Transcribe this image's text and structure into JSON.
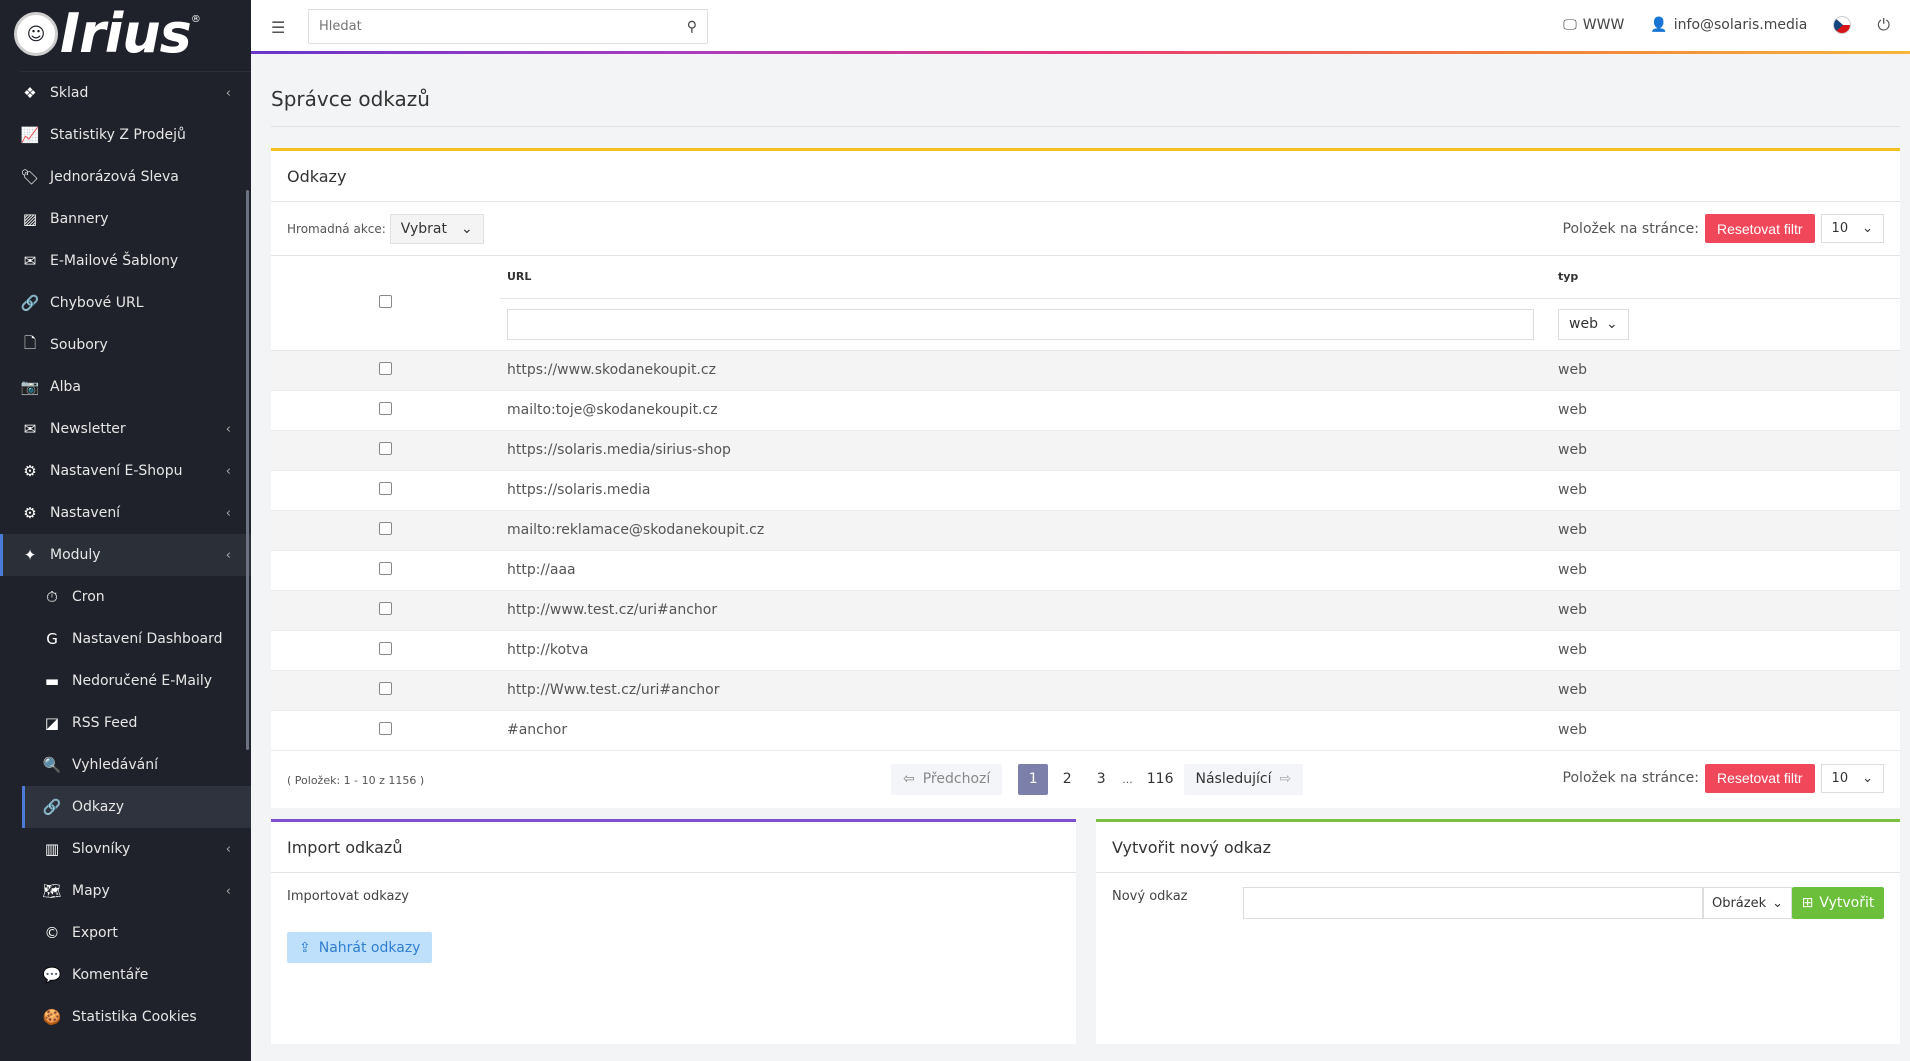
{
  "app": {
    "logo_text": "Irius",
    "logo_mark": "®"
  },
  "sidebar": {
    "items": [
      {
        "label": "Sklad",
        "icon": "boxes-icon",
        "glyph": "❖",
        "chevron": true
      },
      {
        "label": "Statistiky Z Prodejů",
        "icon": "line-chart-icon",
        "glyph": "📈",
        "chevron": false
      },
      {
        "label": "Jednorázová Sleva",
        "icon": "tag-icon",
        "glyph": "🏷",
        "chevron": false
      },
      {
        "label": "Bannery",
        "icon": "image-icon",
        "glyph": "▨",
        "chevron": false
      },
      {
        "label": "E-Mailové Šablony",
        "icon": "envelope-icon",
        "glyph": "✉",
        "chevron": false
      },
      {
        "label": "Chybové URL",
        "icon": "link-icon",
        "glyph": "🔗",
        "chevron": false
      },
      {
        "label": "Soubory",
        "icon": "file-icon",
        "glyph": "🗋",
        "chevron": false
      },
      {
        "label": "Alba",
        "icon": "camera-icon",
        "glyph": "📷",
        "chevron": false
      },
      {
        "label": "Newsletter",
        "icon": "newsletter-icon",
        "glyph": "✉",
        "chevron": true
      },
      {
        "label": "Nastavení E-Shopu",
        "icon": "cogs-icon",
        "glyph": "⚙",
        "chevron": true
      },
      {
        "label": "Nastavení",
        "icon": "cogs-icon",
        "glyph": "⚙",
        "chevron": true
      },
      {
        "label": "Moduly",
        "icon": "modules-icon",
        "glyph": "✦",
        "chevron": true
      }
    ],
    "subitems": [
      {
        "label": "Cron",
        "icon": "stopwatch-icon",
        "glyph": "⏱"
      },
      {
        "label": "Nastavení Dashboard",
        "icon": "google-icon",
        "glyph": "G"
      },
      {
        "label": "Nedoručené E-Maily",
        "icon": "mail-bulk-icon",
        "glyph": "▬"
      },
      {
        "label": "RSS Feed",
        "icon": "rss-icon",
        "glyph": "◪"
      },
      {
        "label": "Vyhledávání",
        "icon": "search-icon",
        "glyph": "🔍"
      },
      {
        "label": "Odkazy",
        "icon": "link-icon",
        "glyph": "🔗"
      },
      {
        "label": "Slovníky",
        "icon": "books-icon",
        "glyph": "▥",
        "chevron": true
      },
      {
        "label": "Mapy",
        "icon": "map-icon",
        "glyph": "🗺",
        "chevron": true
      },
      {
        "label": "Export",
        "icon": "copyright-icon",
        "glyph": "©"
      },
      {
        "label": "Komentáře",
        "icon": "comments-icon",
        "glyph": "💬"
      },
      {
        "label": "Statistika Cookies",
        "icon": "cookie-icon",
        "glyph": "🍪"
      }
    ]
  },
  "topbar": {
    "search_placeholder": "Hledat",
    "www_label": "WWW",
    "user_email": "info@solaris.media"
  },
  "page": {
    "title": "Správce odkazů"
  },
  "links_card": {
    "title": "Odkazy",
    "bulk_label": "Hromadná akce:",
    "bulk_value": "Vybrat",
    "per_page_label": "Položek na stránce:",
    "reset_label": "Resetovat filtr",
    "per_page_value": "10",
    "columns": {
      "url": "URL",
      "typ": "typ"
    },
    "filter_typ_value": "web",
    "rows": [
      {
        "url": "https://www.skodanekoupit.cz",
        "typ": "web"
      },
      {
        "url": "mailto:toje@skodanekoupit.cz",
        "typ": "web"
      },
      {
        "url": "https://solaris.media/sirius-shop",
        "typ": "web"
      },
      {
        "url": "https://solaris.media",
        "typ": "web"
      },
      {
        "url": "mailto:reklamace@skodanekoupit.cz",
        "typ": "web"
      },
      {
        "url": "http://aaa",
        "typ": "web"
      },
      {
        "url": "http://www.test.cz/uri#anchor",
        "typ": "web"
      },
      {
        "url": "http://kotva",
        "typ": "web"
      },
      {
        "url": "http://Www.test.cz/uri#anchor",
        "typ": "web"
      },
      {
        "url": "#anchor",
        "typ": "web"
      }
    ],
    "count_text": "( Položek: 1 - 10 z 1156 )",
    "pager": {
      "prev": "Předchozí",
      "next": "Následující",
      "pages": [
        "1",
        "2",
        "3"
      ],
      "dots": "...",
      "last": "116"
    }
  },
  "import_card": {
    "title": "Import odkazů",
    "label": "Importovat odkazy",
    "button": "Nahrát odkazy"
  },
  "create_card": {
    "title": "Vytvořit nový odkaz",
    "label": "Nový odkaz",
    "type_value": "Obrázek",
    "button": "Vytvořit"
  },
  "colors": {
    "sidebar_bg": "#1f222a",
    "reset_red": "#f0485a",
    "create_green": "#6bbf3b",
    "odkazy_border": "#f4c21f",
    "import_border": "#7b4fd0",
    "create_border": "#7cc043",
    "pager_active": "#7c7fa9"
  }
}
